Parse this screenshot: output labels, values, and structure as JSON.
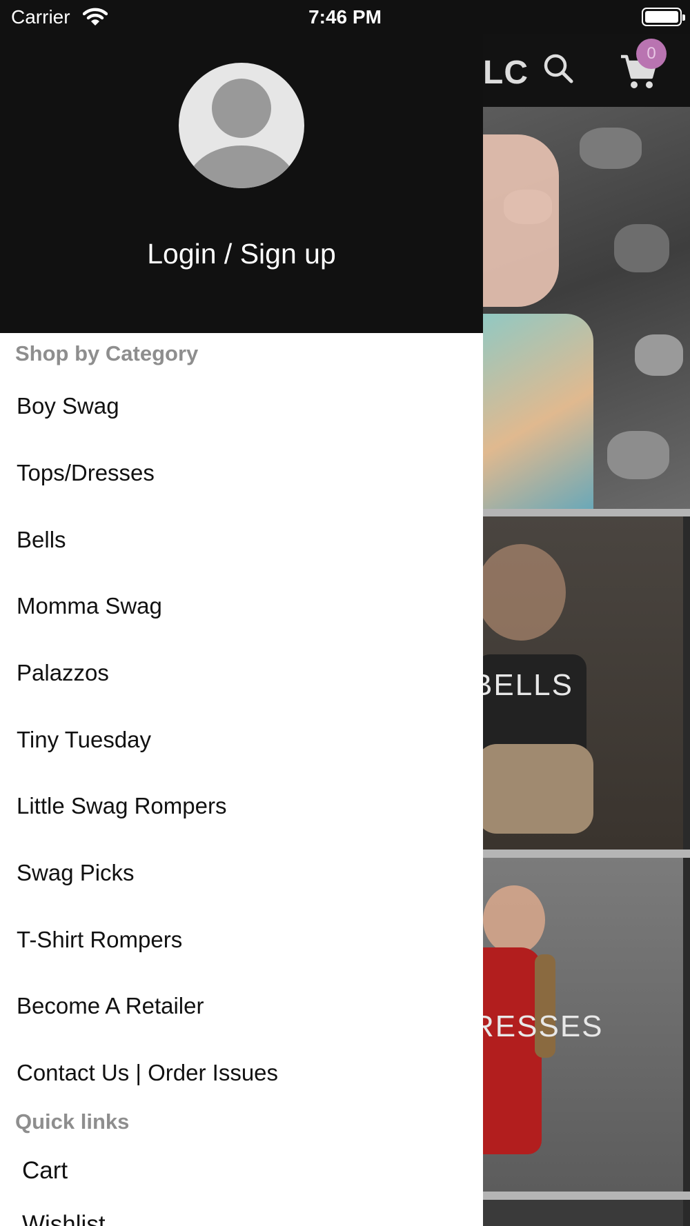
{
  "status_bar": {
    "carrier": "Carrier",
    "time": "7:46 PM"
  },
  "app": {
    "title_fragment": "LC",
    "cart_count": "0",
    "tiles": [
      {
        "label": ""
      },
      {
        "label": "BELLS"
      },
      {
        "label": "RESSES"
      }
    ]
  },
  "drawer": {
    "login_label": "Login / Sign up",
    "shop_section_title": "Shop by Category",
    "categories": [
      "Boy Swag",
      "Tops/Dresses",
      "Bells",
      "Momma Swag",
      "Palazzos",
      "Tiny Tuesday",
      "Little Swag Rompers",
      "Swag Picks",
      "T-Shirt Rompers",
      "Become A Retailer",
      "Contact Us | Order Issues"
    ],
    "quick_section_title": "Quick links",
    "quick_links": [
      "Cart",
      "Wishlist"
    ]
  },
  "colors": {
    "drawer_header": "#111111",
    "badge": "#b974b1",
    "section_title": "#8e8e8e"
  }
}
